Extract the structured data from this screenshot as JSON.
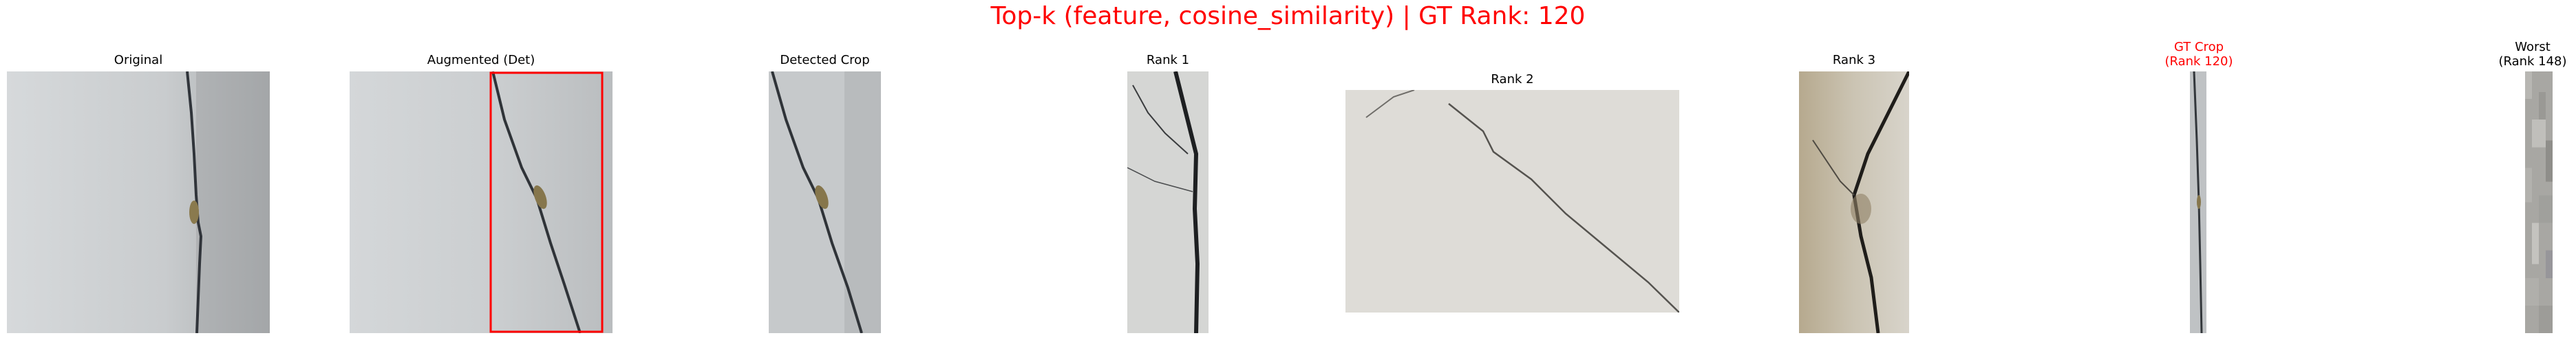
{
  "figure": {
    "title": "Top-k (feature, cosine_similarity) | GT Rank: 120",
    "title_color": "#ff0000"
  },
  "panels": [
    {
      "id": "original",
      "title": "Original"
    },
    {
      "id": "augmented",
      "title": "Augmented (Det)"
    },
    {
      "id": "detected",
      "title": "Detected Crop"
    },
    {
      "id": "rank1",
      "title": "Rank 1"
    },
    {
      "id": "rank2",
      "title": "Rank 2"
    },
    {
      "id": "rank3",
      "title": "Rank 3"
    },
    {
      "id": "gt",
      "title_line1": "GT Crop",
      "title_line2": "(Rank 120)",
      "title_color": "#ff0000"
    },
    {
      "id": "worst",
      "title_line1": "Worst",
      "title_line2": "(Rank 148)"
    }
  ],
  "colors": {
    "detection_box": "#ff0000",
    "concrete_light": "#d9dcde",
    "concrete_mid": "#b7babc",
    "concrete_dark": "#9c9fa1",
    "crack": "#2a2d30"
  }
}
